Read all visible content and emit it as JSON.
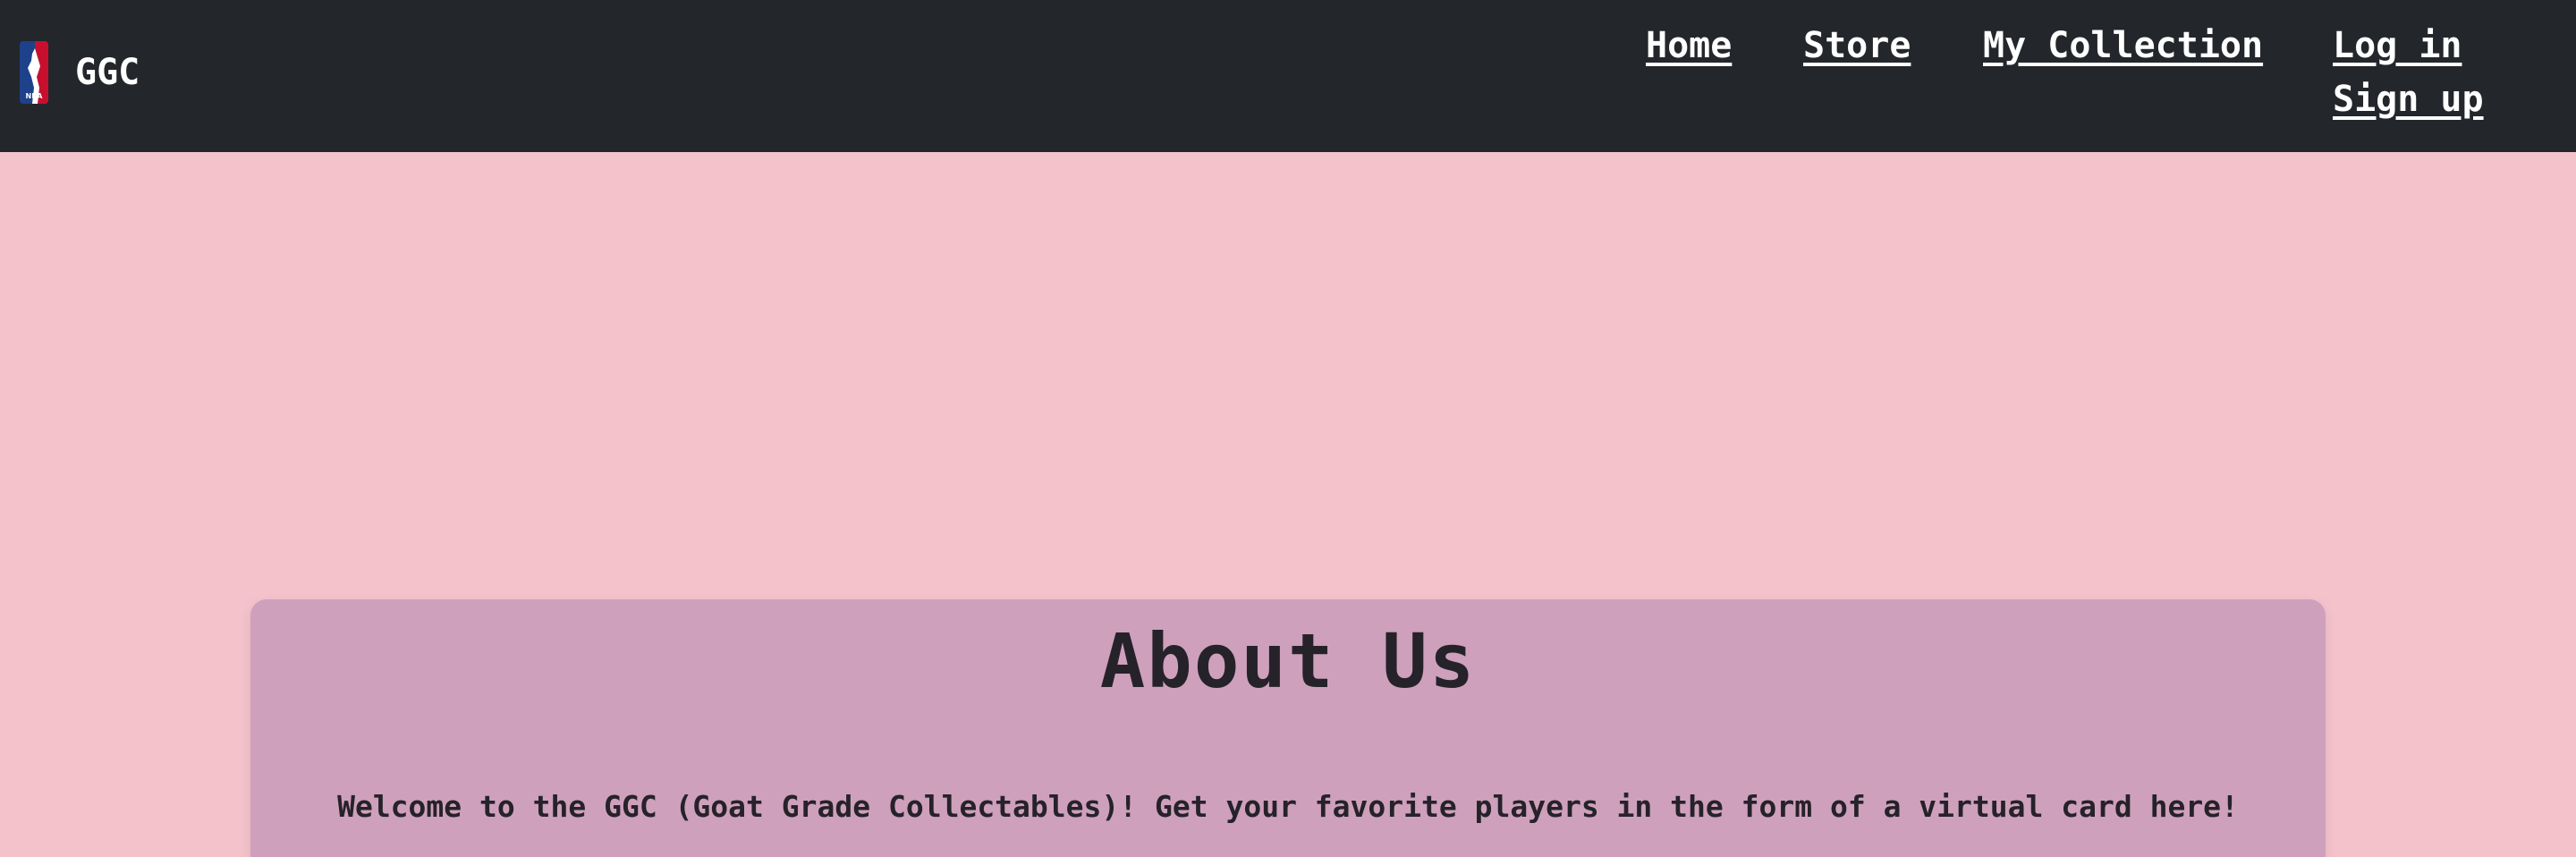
{
  "brand": {
    "name": "GGC",
    "logo_icon": "nba-logo-icon"
  },
  "nav": {
    "home": "Home",
    "store": "Store",
    "my_collection": "My Collection",
    "login": "Log in",
    "signup": "Sign up"
  },
  "about": {
    "title": "About Us",
    "welcome": "Welcome to the GGC (Goat Grade Collectables)! Get your favorite players in the form of a virtual card here!"
  },
  "colors": {
    "navbar": "#23262b",
    "page_background": "#f4c2cb",
    "card_background": "#cea0bc",
    "text_dark": "#26222a",
    "nav_text": "#ffffff"
  }
}
